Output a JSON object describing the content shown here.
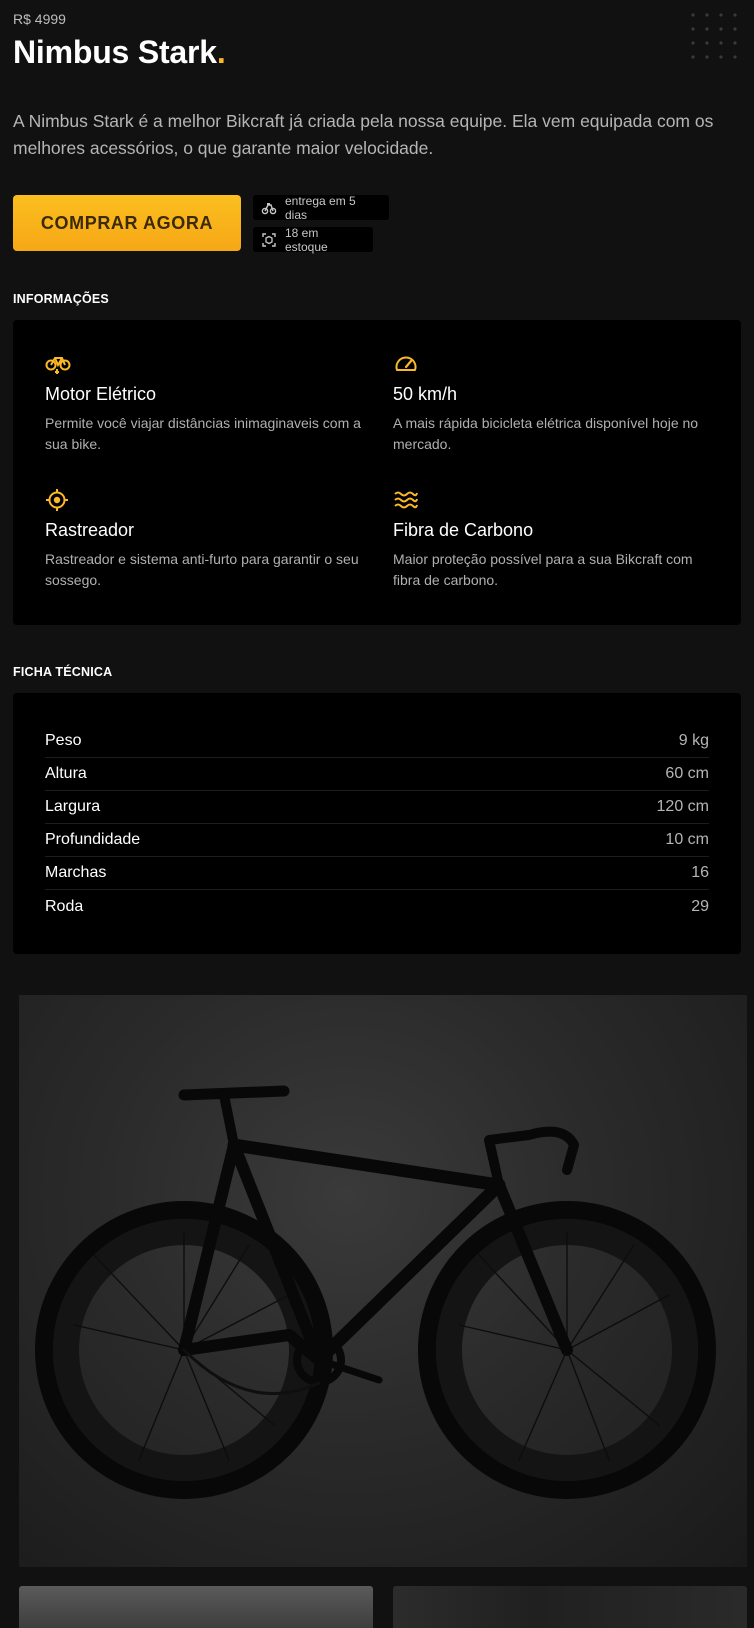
{
  "product": {
    "price": "R$ 4999",
    "name": "Nimbus Stark",
    "name_dot": ".",
    "description": "A Nimbus Stark é a melhor Bikcraft já criada pela nossa equipe. Ela vem equipada com os melhores acessórios, o que garante maior velocidade."
  },
  "actions": {
    "buy_label": "COMPRAR AGORA"
  },
  "badges": {
    "delivery": {
      "icon": "delivery-bike-icon",
      "text": "entrega em 5 dias"
    },
    "stock": {
      "icon": "stock-box-icon",
      "text": "18 em estoque"
    }
  },
  "info": {
    "heading": "INFORMAÇÕES",
    "features": [
      {
        "icon": "bike-motor-icon",
        "title": "Motor Elétrico",
        "text": "Permite você viajar distâncias inimaginaveis com a sua bike."
      },
      {
        "icon": "speedometer-icon",
        "title": "50 km/h",
        "text": "A mais rápida bicicleta elétrica disponível hoje no mercado."
      },
      {
        "icon": "tracker-icon",
        "title": "Rastreador",
        "text": "Rastreador e sistema anti-furto para garantir o seu sossego."
      },
      {
        "icon": "carbon-waves-icon",
        "title": "Fibra de Carbono",
        "text": "Maior proteção possível para a sua Bikcraft com fibra de carbono."
      }
    ]
  },
  "specs": {
    "heading": "FICHA TÉCNICA",
    "rows": [
      {
        "label": "Peso",
        "value": "9 kg"
      },
      {
        "label": "Altura",
        "value": "60 cm"
      },
      {
        "label": "Largura",
        "value": "120 cm"
      },
      {
        "label": "Profundidade",
        "value": "10 cm"
      },
      {
        "label": "Marchas",
        "value": "16"
      },
      {
        "label": "Roda",
        "value": "29"
      }
    ]
  },
  "gallery": {
    "images": [
      "bike-photo-main",
      "bike-photo-thumb-1",
      "bike-photo-thumb-2"
    ]
  },
  "colors": {
    "accent": "#fbb827",
    "background": "#111111",
    "panel": "#000000"
  }
}
